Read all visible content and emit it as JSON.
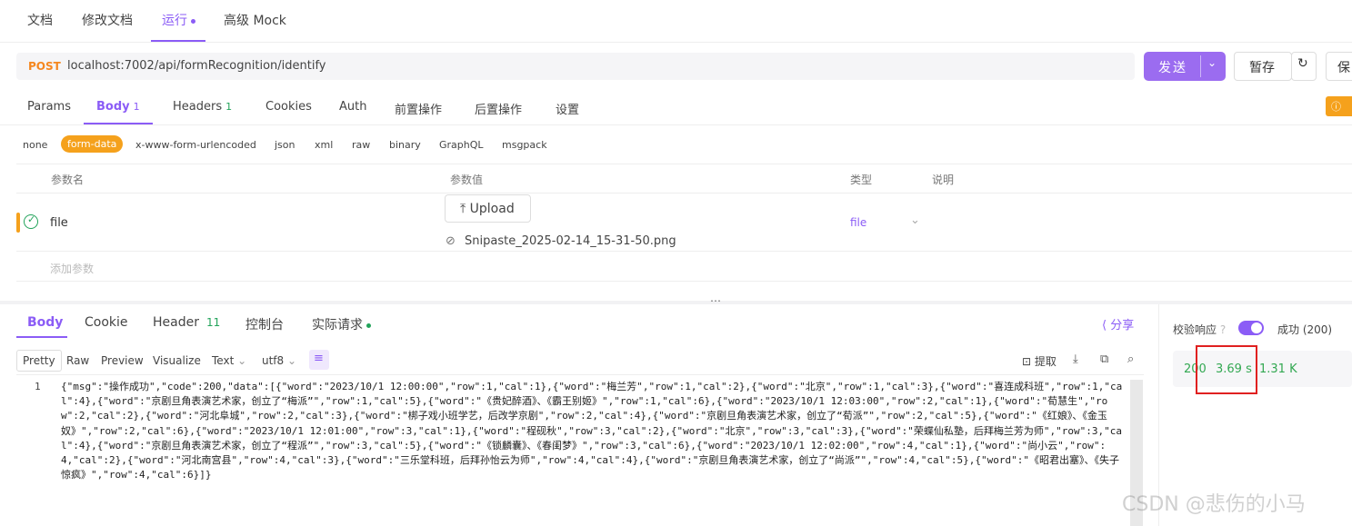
{
  "top_tabs": [
    "文档",
    "修改文档",
    "运行",
    "高级 Mock"
  ],
  "request": {
    "method": "POST",
    "url": "localhost:7002/api/formRecognition/identify",
    "send_label": "发送",
    "save_label": "暂存",
    "save2_label": "保"
  },
  "sub_tabs": {
    "params": "Params",
    "body": "Body",
    "body_count": "1",
    "headers": "Headers",
    "headers_count": "1",
    "cookies": "Cookies",
    "auth": "Auth",
    "pre": "前置操作",
    "post": "后置操作",
    "settings": "设置"
  },
  "body_types": [
    "none",
    "form-data",
    "x-www-form-urlencoded",
    "json",
    "xml",
    "raw",
    "binary",
    "GraphQL",
    "msgpack"
  ],
  "table": {
    "headers": [
      "参数名",
      "参数值",
      "类型",
      "说明"
    ],
    "row": {
      "name": "file",
      "upload_label": "Upload",
      "filename": "Snipaste_2025-02-14_15-31-50.png",
      "type": "file"
    },
    "add_placeholder": "添加参数"
  },
  "response": {
    "tabs": {
      "body": "Body",
      "cookie": "Cookie",
      "header": "Header",
      "header_count": "11",
      "console": "控制台",
      "actual": "实际请求"
    },
    "share": "分享",
    "views": [
      "Pretty",
      "Raw",
      "Preview",
      "Visualize",
      "Text",
      "utf8"
    ],
    "extract": "提取",
    "line_number": "1",
    "body_text": "{\"msg\":\"操作成功\",\"code\":200,\"data\":[{\"word\":\"2023/10/1 12:00:00\",\"row\":1,\"cal\":1},{\"word\":\"梅兰芳\",\"row\":1,\"cal\":2},{\"word\":\"北京\",\"row\":1,\"cal\":3},{\"word\":\"喜连成科班\",\"row\":1,\"cal\":4},{\"word\":\"京剧旦角表演艺术家，创立了“梅派”\",\"row\":1,\"cal\":5},{\"word\":\"《贵妃醉酒》、《霸王别姬》\",\"row\":1,\"cal\":6},{\"word\":\"2023/10/1 12:03:00\",\"row\":2,\"cal\":1},{\"word\":\"荀慧生\",\"row\":2,\"cal\":2},{\"word\":\"河北阜城\",\"row\":2,\"cal\":3},{\"word\":\"梆子戏小班学艺，后改学京剧\",\"row\":2,\"cal\":4},{\"word\":\"京剧旦角表演艺术家，创立了“荀派”\",\"row\":2,\"cal\":5},{\"word\":\"《红娘》、《金玉奴》\",\"row\":2,\"cal\":6},{\"word\":\"2023/10/1 12:01:00\",\"row\":3,\"cal\":1},{\"word\":\"程砚秋\",\"row\":3,\"cal\":2},{\"word\":\"北京\",\"row\":3,\"cal\":3},{\"word\":\"荣蝶仙私塾，后拜梅兰芳为师\",\"row\":3,\"cal\":4},{\"word\":\"京剧旦角表演艺术家，创立了“程派”\",\"row\":3,\"cal\":5},{\"word\":\"《锁麟囊》、《春闺梦》\",\"row\":3,\"cal\":6},{\"word\":\"2023/10/1 12:02:00\",\"row\":4,\"cal\":1},{\"word\":\"尚小云\",\"row\":4,\"cal\":2},{\"word\":\"河北南宫县\",\"row\":4,\"cal\":3},{\"word\":\"三乐堂科班，后拜孙怡云为师\",\"row\":4,\"cal\":4},{\"word\":\"京剧旦角表演艺术家，创立了“尚派”\",\"row\":4,\"cal\":5},{\"word\":\"《昭君出塞》、《失子惊疯》\",\"row\":4,\"cal\":6}]}"
  },
  "side_panel": {
    "validate_label": "校验响应",
    "result": "成功 (200)",
    "status": "200",
    "time": "3.69 s",
    "size": "1.31 K"
  },
  "watermark": "CSDN @悲伤的小马",
  "colors": {
    "accent": "#8b5cf6",
    "post": "#f5871f",
    "success": "#33a852",
    "highlight": "#e02020"
  }
}
